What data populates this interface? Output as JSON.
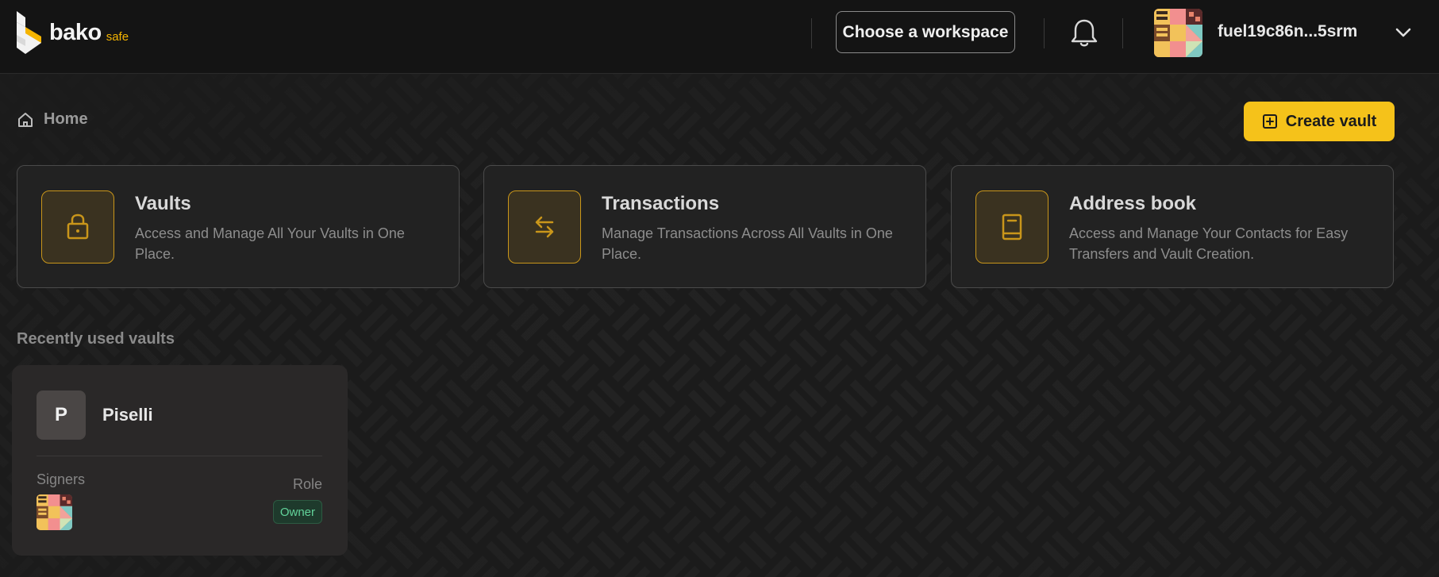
{
  "header": {
    "logo_text": "bako",
    "logo_sub": "safe",
    "workspace_button": "Choose a workspace",
    "account_address": "fuel19c86n...5srm"
  },
  "breadcrumb": {
    "home_label": "Home"
  },
  "actions": {
    "create_vault": "Create vault"
  },
  "cards": [
    {
      "title": "Vaults",
      "description": "Access and Manage All Your Vaults in One Place.",
      "icon": "lock-icon"
    },
    {
      "title": "Transactions",
      "description": "Manage Transactions Across All Vaults in One Place.",
      "icon": "transfer-arrows-icon"
    },
    {
      "title": "Address book",
      "description": "Access and Manage Your Contacts for Easy Transfers and Vault Creation.",
      "icon": "book-icon"
    }
  ],
  "recent": {
    "section_title": "Recently used vaults",
    "vaults": [
      {
        "initial": "P",
        "name": "Piselli",
        "signers_label": "Signers",
        "role_label": "Role",
        "role": "Owner"
      }
    ]
  },
  "colors": {
    "accent": "#f5c21a",
    "background": "#1b1b1b",
    "card_border": "#c9961a",
    "owner_badge_text": "#62d39a"
  }
}
